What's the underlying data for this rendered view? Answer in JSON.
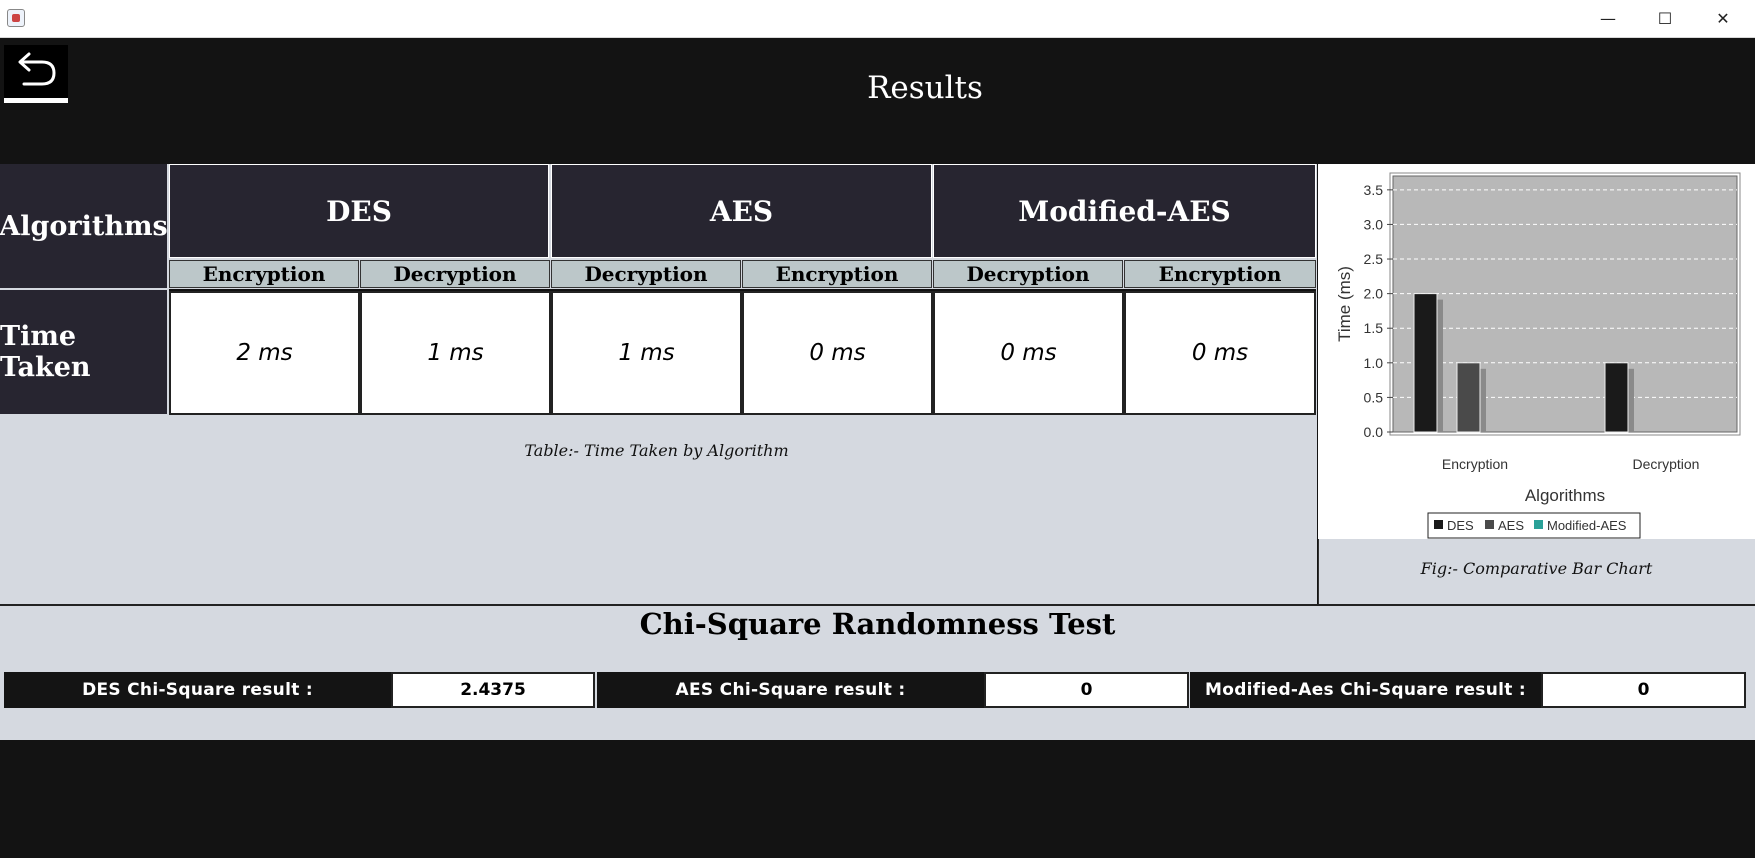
{
  "window": {
    "minimize": "—",
    "maximize": "☐",
    "close": "✕"
  },
  "header": {
    "title": "Results",
    "back_icon": "undo-arrow-icon"
  },
  "table": {
    "row_header_algorithms": "Algorithms",
    "row_header_time": "Time Taken",
    "algorithms": [
      "DES",
      "AES",
      "Modified-AES"
    ],
    "sub_headers": [
      "Encryption",
      "Decryption",
      "Decryption",
      "Encryption",
      "Decryption",
      "Encryption"
    ],
    "values": [
      "2 ms",
      "1 ms",
      "1 ms",
      "0 ms",
      "0 ms",
      "0 ms"
    ],
    "caption": "Table:- Time Taken by Algorithm"
  },
  "chart_data": {
    "type": "bar",
    "categories": [
      "Encryption",
      "Decryption"
    ],
    "series": [
      {
        "name": "DES",
        "values": [
          2,
          1
        ],
        "color": "#1a1a1a"
      },
      {
        "name": "AES",
        "values": [
          1,
          0
        ],
        "color": "#4a4a4a"
      },
      {
        "name": "Modified-AES",
        "values": [
          0,
          0
        ],
        "color": "#2aa198"
      }
    ],
    "ylim": [
      0,
      3.7
    ],
    "yticks": [
      "0.0",
      "0.5",
      "1.0",
      "1.5",
      "2.0",
      "2.5",
      "3.0",
      "3.5"
    ],
    "xlabel": "Algorithms",
    "ylabel": "Time (ms)",
    "grid": true,
    "legend": "bottom",
    "plot_background": "#b8b8b8",
    "caption": "Fig:- Comparative Bar Chart"
  },
  "chi_square": {
    "title": "Chi-Square Randomness Test",
    "des_label": "DES Chi-Square result :",
    "des_value": "2.4375",
    "aes_label": "AES Chi-Square result :",
    "aes_value": "0",
    "maes_label": "Modified-Aes Chi-Square result :",
    "maes_value": "0"
  }
}
